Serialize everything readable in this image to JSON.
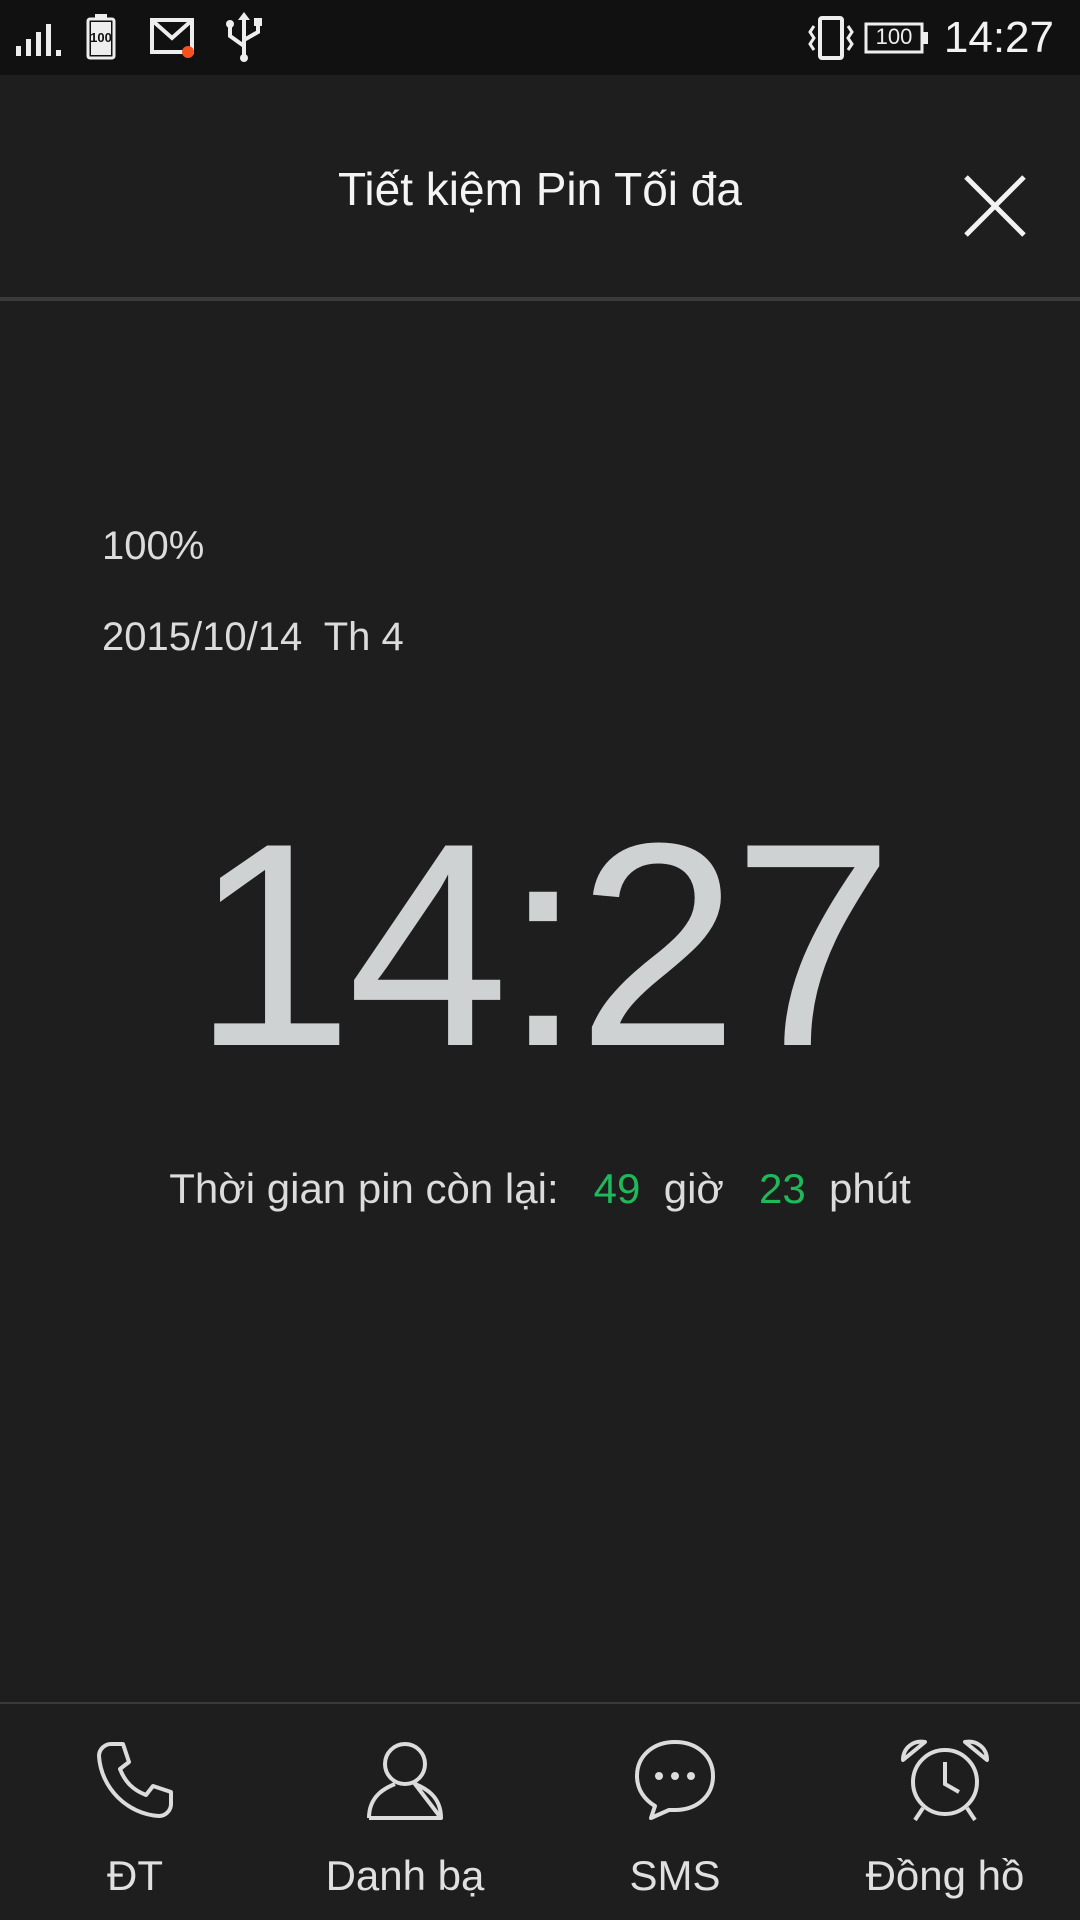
{
  "status_bar": {
    "battery_small_label": "100",
    "battery_label": "100",
    "time": "14:27"
  },
  "header": {
    "title": "Tiết kiệm Pin Tối đa"
  },
  "info": {
    "battery_percent": "100%",
    "date": "2015/10/14  Th 4",
    "clock": "14:27",
    "remaining": {
      "label": "Thời gian pin còn lại:",
      "hours": "49",
      "hours_unit": "giờ",
      "minutes": "23",
      "minutes_unit": "phút"
    }
  },
  "bottom_nav": {
    "items": [
      {
        "label": "ĐT",
        "icon": "phone-icon"
      },
      {
        "label": "Danh bạ",
        "icon": "contact-icon"
      },
      {
        "label": "SMS",
        "icon": "message-icon"
      },
      {
        "label": "Đồng hồ",
        "icon": "alarm-clock-icon"
      }
    ]
  },
  "colors": {
    "background": "#1e1e1e",
    "accent": "#1fb85a"
  }
}
